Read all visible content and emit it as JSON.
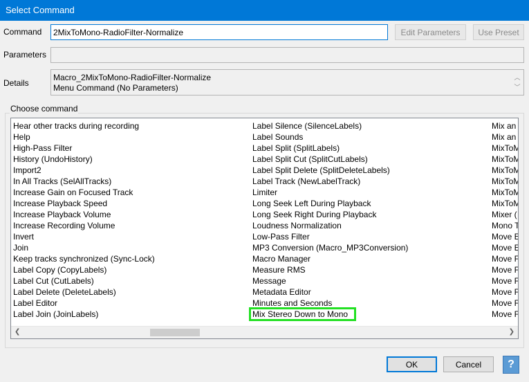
{
  "window": {
    "title": "Select Command"
  },
  "form": {
    "command_label": "Command",
    "command_value": "2MixToMono-RadioFilter-Normalize",
    "edit_params_label": "Edit Parameters",
    "use_preset_label": "Use Preset",
    "parameters_label": "Parameters",
    "parameters_value": "",
    "details_label": "Details",
    "details_line1": "Macro_2MixToMono-RadioFilter-Normalize",
    "details_line2": "Menu Command (No Parameters)"
  },
  "choose": {
    "label": "Choose command",
    "col1": [
      "Hear other tracks during recording",
      "Help",
      "High-Pass Filter",
      "History (UndoHistory)",
      "Import2",
      "In All Tracks (SelAllTracks)",
      "Increase Gain on Focused Track",
      "Increase Playback Speed",
      "Increase Playback Volume",
      "Increase Recording Volume",
      "Invert",
      "Join",
      "Keep tracks synchronized (Sync-Lock)",
      "Label Copy (CopyLabels)",
      "Label Cut (CutLabels)",
      "Label Delete (DeleteLabels)",
      "Label Editor",
      "Label Join (JoinLabels)"
    ],
    "col2": [
      "Label Silence (SilenceLabels)",
      "Label Sounds",
      "Label Split (SplitLabels)",
      "Label Split Cut (SplitCutLabels)",
      "Label Split Delete (SplitDeleteLabels)",
      "Label Track (NewLabelTrack)",
      "Limiter",
      "Long Seek Left During Playback",
      "Long Seek Right During Playback",
      "Loudness Normalization",
      "Low-Pass Filter",
      "MP3 Conversion (Macro_MP3Conversion)",
      "Macro Manager",
      "Measure RMS",
      "Message",
      "Metadata Editor",
      "Minutes and Seconds",
      "Mix Stereo Down to Mono"
    ],
    "col3": [
      "Mix an",
      "Mix an",
      "MixToM",
      "MixToM",
      "MixToM",
      "MixToM",
      "MixToM",
      "MixToM",
      "Mixer (",
      "Mono T",
      "Move E",
      "Move E",
      "Move F",
      "Move F",
      "Move F",
      "Move F",
      "Move F",
      "Move F"
    ],
    "highlighted_item": "Mix Stereo Down to Mono"
  },
  "buttons": {
    "ok": "OK",
    "cancel": "Cancel",
    "help": "?"
  }
}
